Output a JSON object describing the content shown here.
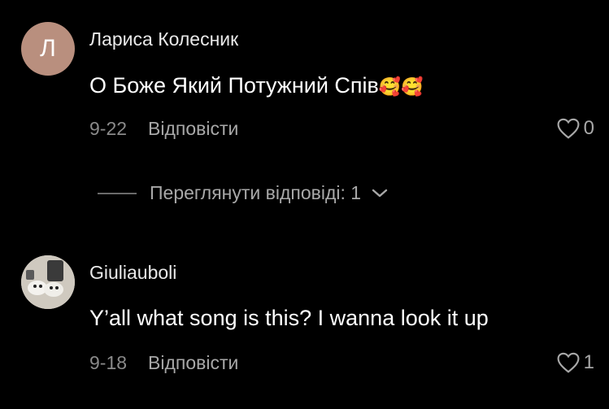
{
  "comments": [
    {
      "avatar_letter": "Л",
      "username": "Лариса Колесник",
      "text": "О Боже Який Потужний Спів",
      "emoji": "🥰🥰",
      "date": "9-22",
      "reply_label": "Відповісти",
      "likes": "0"
    },
    {
      "username": "Giuliauboli",
      "text": "Y’all what song is this? I wanna look it up",
      "date": "9-18",
      "reply_label": "Відповісти",
      "likes": "1"
    }
  ],
  "view_replies": {
    "label": "Переглянути відповіді: 1",
    "icon": "chevron-down-icon"
  },
  "colors": {
    "background": "#000000",
    "muted": "#a8a8a8",
    "avatar": "#b98f7e"
  }
}
